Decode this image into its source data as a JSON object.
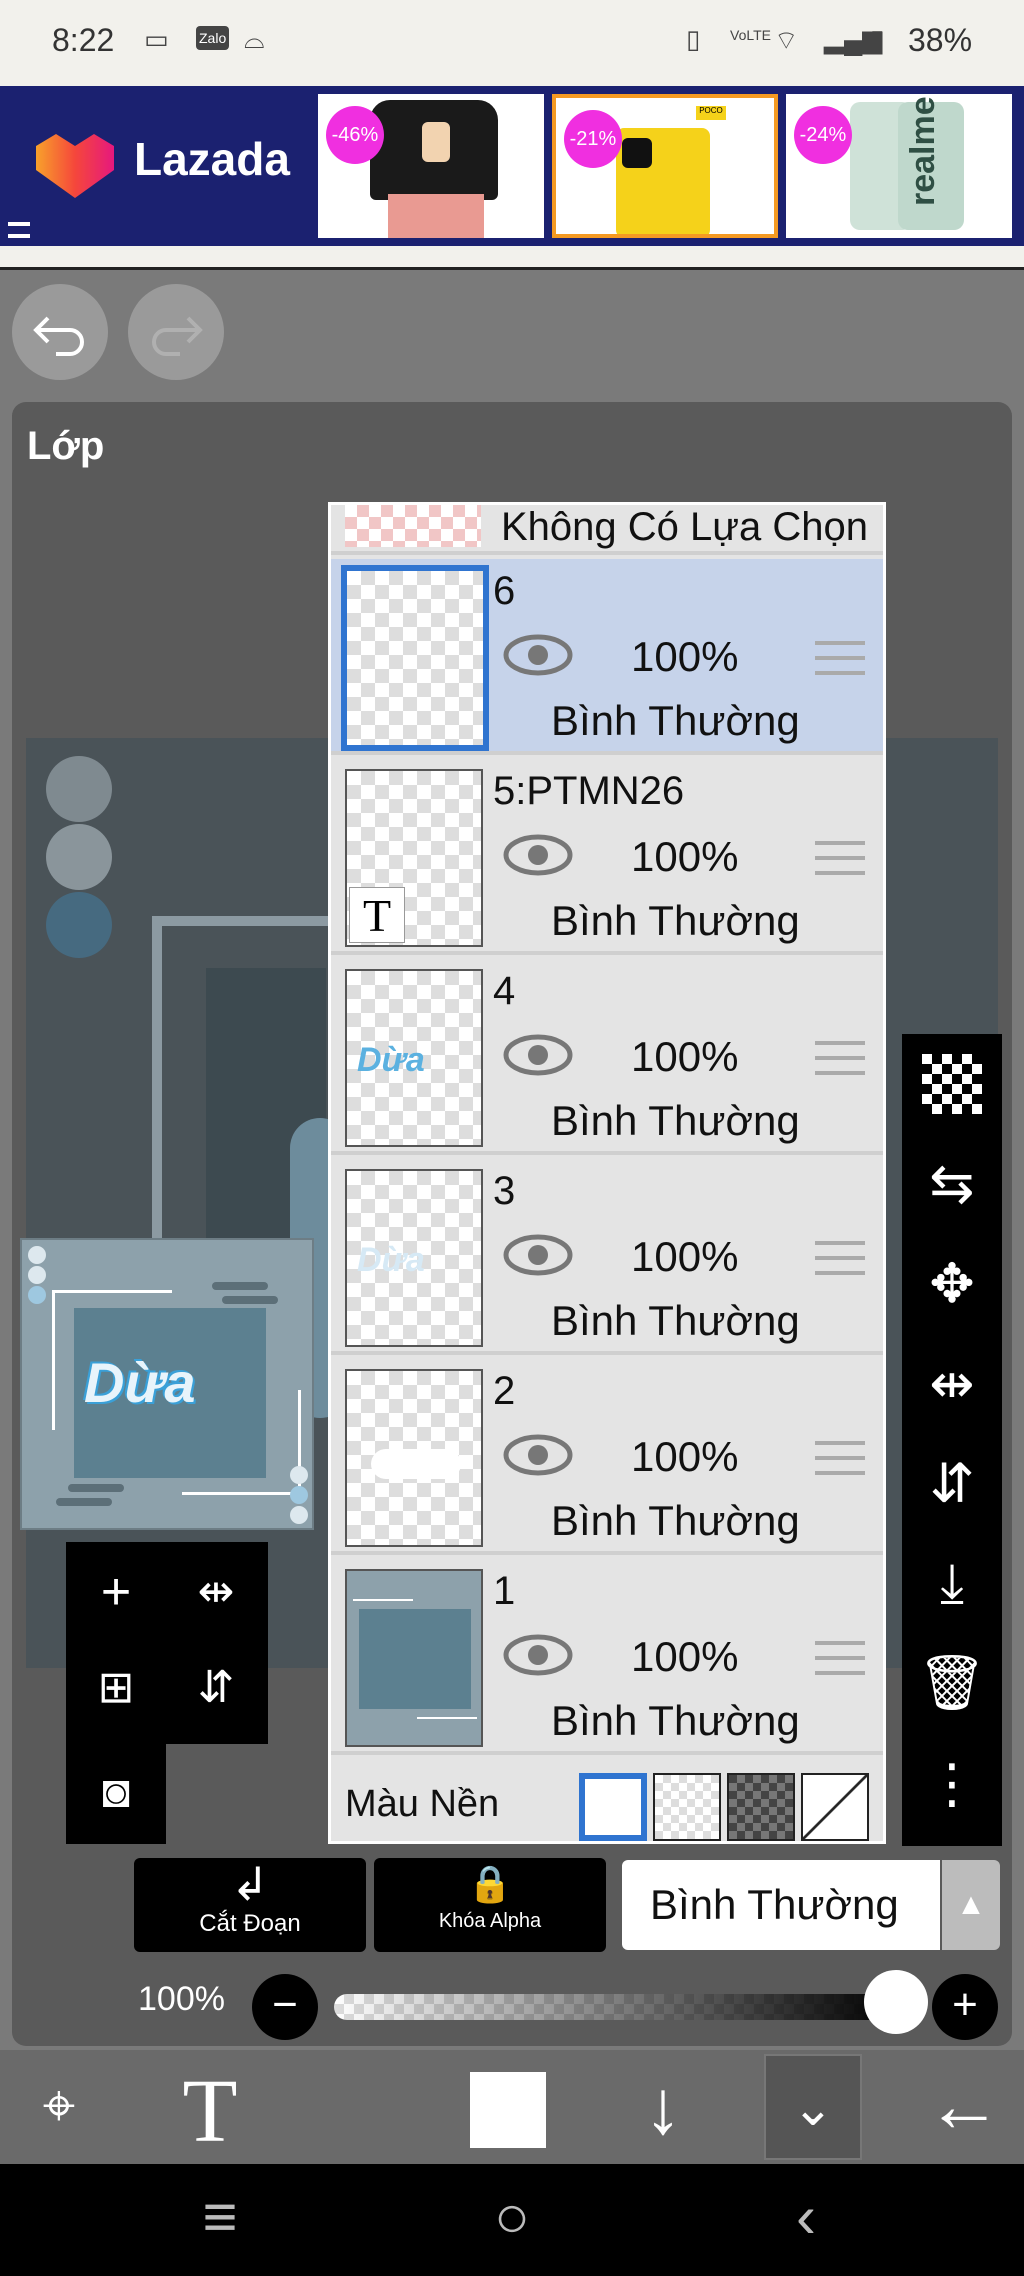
{
  "status_bar": {
    "time": "8:22",
    "battery": "38%",
    "icons": [
      "video-icon",
      "zalo-icon",
      "incognito-icon",
      "vibrate-icon",
      "volte-icon",
      "wifi-icon",
      "signal-icon",
      "battery-icon"
    ],
    "zalo_label": "Zalo",
    "volte_label": "VoLTE"
  },
  "ad": {
    "brand": "Lazada",
    "products": [
      {
        "discount": "-46%"
      },
      {
        "discount": "-21%",
        "tag": "POCO"
      },
      {
        "discount": "-24%",
        "text": "realme"
      }
    ]
  },
  "panel": {
    "title": "Lớp"
  },
  "layers": {
    "no_selection": "Không Có Lựa Chọn",
    "items": [
      {
        "name": "6",
        "opacity": "100%",
        "blend": "Bình Thường",
        "selected": true
      },
      {
        "name": "5:PTMN26",
        "opacity": "100%",
        "blend": "Bình Thường",
        "badge": "T"
      },
      {
        "name": "4",
        "opacity": "100%",
        "blend": "Bình Thường",
        "thumb_text": "Dừa"
      },
      {
        "name": "3",
        "opacity": "100%",
        "blend": "Bình Thường",
        "thumb_text": "Dừa"
      },
      {
        "name": "2",
        "opacity": "100%",
        "blend": "Bình Thường"
      },
      {
        "name": "1",
        "opacity": "100%",
        "blend": "Bình Thường"
      }
    ],
    "background_label": "Màu Nền"
  },
  "thumbnail": {
    "text": "Dừa"
  },
  "controls": {
    "clip_label": "Cắt Đoạn",
    "alpha_lock_label": "Khóa Alpha",
    "blend_mode": "Bình Thường",
    "opacity_label": "100%",
    "opacity_value": 1.0
  },
  "colors": {
    "selected_layer": "#c6d3ea",
    "selected_border": "#2f74d0",
    "ad_background": "#1b2170",
    "discount_badge": "#f02fe0"
  }
}
